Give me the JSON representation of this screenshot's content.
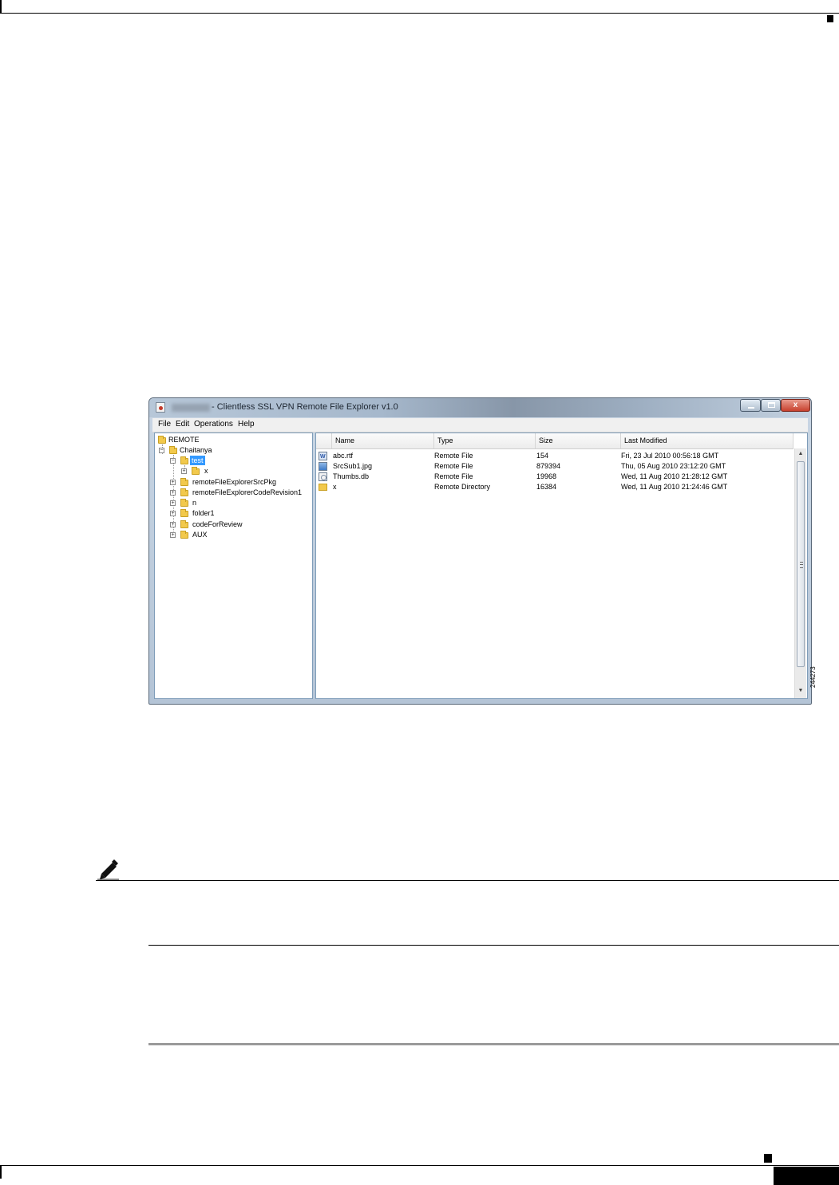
{
  "window": {
    "title": "- Clientless SSL VPN Remote File Explorer v1.0",
    "close_label": "x"
  },
  "menu": [
    "File",
    "Edit",
    "Operations",
    "Help"
  ],
  "tree": {
    "root": "REMOTE",
    "user": "Chaitanya",
    "selected": "test",
    "test_child": "x",
    "folders": [
      "remoteFileExplorerSrcPkg",
      "remoteFileExplorerCodeRevision1",
      "n",
      "folder1",
      "codeForReview",
      "AUX"
    ]
  },
  "files": {
    "columns": [
      "Name",
      "Type",
      "Size",
      "Last Modified"
    ],
    "rows": [
      {
        "icon": "rtf-document-icon",
        "name": "abc.rtf",
        "type": "Remote File",
        "size": "154",
        "modified": "Fri, 23 Jul 2010 00:56:18 GMT"
      },
      {
        "icon": "image-file-icon",
        "name": "SrcSub1.jpg",
        "type": "Remote File",
        "size": "879394",
        "modified": "Thu, 05 Aug 2010 23:12:20 GMT"
      },
      {
        "icon": "database-file-icon",
        "name": "Thumbs.db",
        "type": "Remote File",
        "size": "19968",
        "modified": "Wed, 11 Aug 2010 21:28:12 GMT"
      },
      {
        "icon": "folder-icon",
        "name": "x",
        "type": "Remote Directory",
        "size": "16384",
        "modified": "Wed, 11 Aug 2010 21:24:46 GMT"
      }
    ]
  },
  "figure_id": "244273"
}
